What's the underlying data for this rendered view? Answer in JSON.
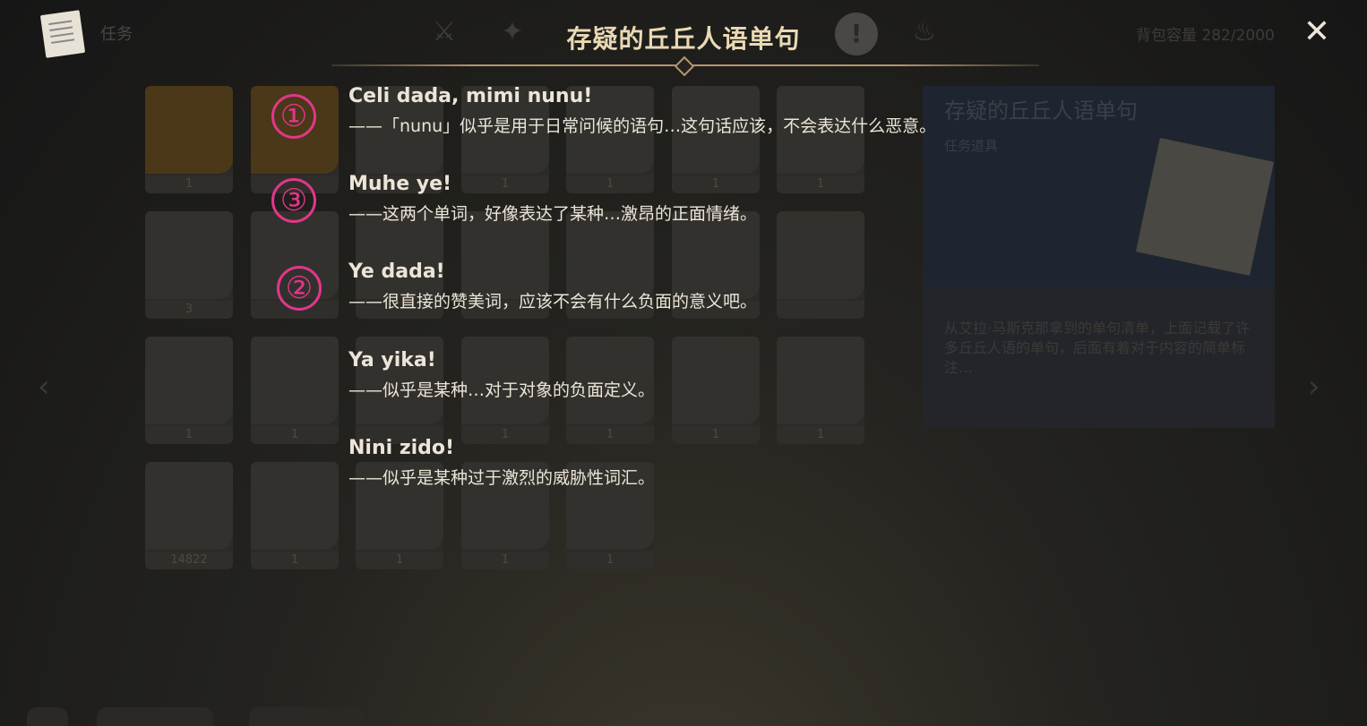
{
  "header": {
    "category_label": "任务",
    "title": "存疑的丘丘人语单句",
    "capacity": "背包容量 282/2000",
    "close_symbol": "✕",
    "alert_symbol": "!"
  },
  "inventory": {
    "slots": [
      {
        "count": "1"
      },
      {
        "count": ""
      },
      {
        "count": ""
      },
      {
        "count": "1"
      },
      {
        "count": "1"
      },
      {
        "count": "1"
      },
      {
        "count": "1"
      },
      {
        "count": "3"
      },
      {
        "count": ""
      },
      {
        "count": ""
      },
      {
        "count": ""
      },
      {
        "count": ""
      },
      {
        "count": ""
      },
      {
        "count": ""
      },
      {
        "count": "1"
      },
      {
        "count": "1"
      },
      {
        "count": ""
      },
      {
        "count": "1"
      },
      {
        "count": "1"
      },
      {
        "count": "1"
      },
      {
        "count": "1"
      },
      {
        "count": "14822"
      },
      {
        "count": "1"
      },
      {
        "count": "1"
      },
      {
        "count": "1"
      },
      {
        "count": "1"
      }
    ]
  },
  "detail": {
    "name": "存疑的丘丘人语单句",
    "type": "任务道具",
    "description": "从艾拉·马斯克那拿到的单句清单，上面记载了许多丘丘人语的单句，后面有着对于内容的简单标注…"
  },
  "phrases": [
    {
      "text": "Celi dada, mimi nunu!",
      "note": "——「nunu」似乎是用于日常问候的语句…这句话应该，不会表达什么恶意。"
    },
    {
      "text": "Muhe ye!",
      "note": "——这两个单词，好像表达了某种…激昂的正面情绪。"
    },
    {
      "text": "Ye dada!",
      "note": "——很直接的赞美词，应该不会有什么负面的意义吧。"
    },
    {
      "text": "Ya yika!",
      "note": "——似乎是某种…对于对象的负面定义。"
    },
    {
      "text": "Nini zido!",
      "note": "——似乎是某种过于激烈的威胁性词汇。"
    }
  ],
  "annotations": [
    "①",
    "③",
    "②"
  ],
  "colors": {
    "marker": "#e2368a",
    "title": "#e9d9b4",
    "text": "#ece5d8"
  },
  "icons": [
    "quest-document-icon",
    "weapon-tab-icon",
    "artifact-tab-icon",
    "quest-tab-icon",
    "precious-tab-icon",
    "close-icon",
    "left-arrow-icon",
    "right-arrow-icon"
  ]
}
